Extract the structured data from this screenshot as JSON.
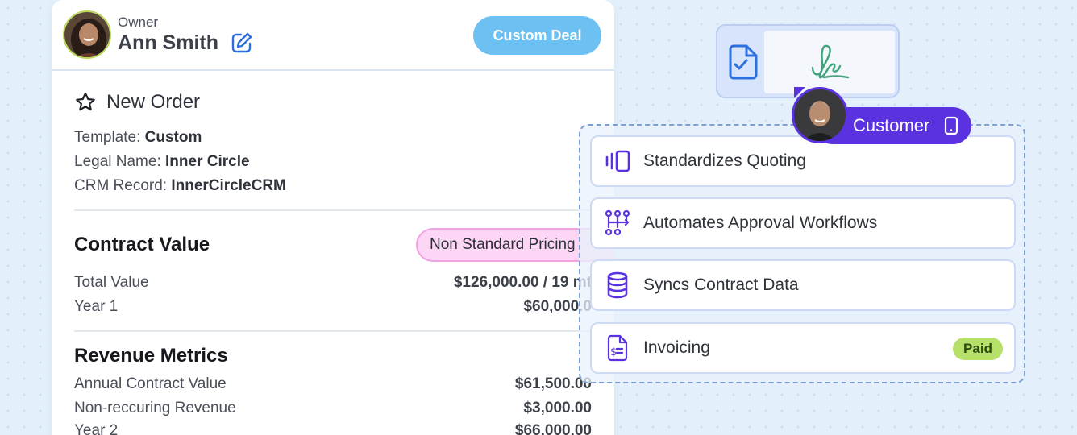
{
  "owner": {
    "label": "Owner",
    "name": "Ann Smith",
    "deal_button": "Custom Deal"
  },
  "order": {
    "title": "New Order",
    "fields": [
      {
        "label": "Template: ",
        "value": "Custom"
      },
      {
        "label": "Legal Name: ",
        "value": "Inner Circle"
      },
      {
        "label": "CRM Record: ",
        "value": "InnerCircleCRM"
      }
    ]
  },
  "contract": {
    "title": "Contract Value",
    "badge": "Non Standard Pricing",
    "rows": [
      {
        "label": "Total Value",
        "value": "$126,000.00 / 19 mt"
      },
      {
        "label": "Year 1",
        "value": "$60,000.0"
      }
    ]
  },
  "revenue": {
    "title": "Revenue Metrics",
    "rows": [
      {
        "label": "Annual Contract Value",
        "value": "$61,500.00"
      },
      {
        "label": "Non-reccuring Revenue",
        "value": "$3,000.00"
      },
      {
        "label": "Year 2",
        "value": "$66,000.00"
      }
    ]
  },
  "customer": {
    "label": "Customer"
  },
  "features": [
    {
      "label": "Standardizes Quoting",
      "icon": "quote-icon"
    },
    {
      "label": "Automates Approval Workflows",
      "icon": "workflow-icon"
    },
    {
      "label": "Syncs Contract Data",
      "icon": "database-icon"
    },
    {
      "label": "Invoicing",
      "icon": "invoice-icon",
      "badge": "Paid"
    }
  ],
  "colors": {
    "accent_purple": "#5a32e0",
    "deal_blue": "#6cc0f2",
    "pricing_pink": "#fcd6f4",
    "paid_green": "#b7e06a"
  }
}
